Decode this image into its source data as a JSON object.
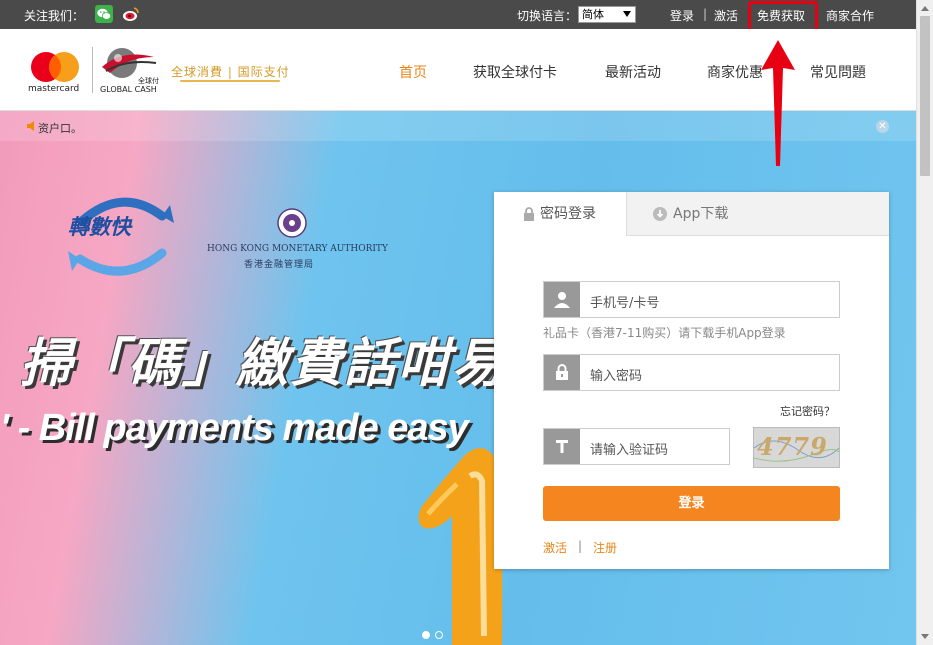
{
  "topbar": {
    "follow_label": "关注我们：",
    "social_icons": [
      "wechat-icon",
      "weibo-icon"
    ],
    "language_label": "切换语言：",
    "language_selected": "简体",
    "links": [
      "登录",
      "激活",
      "免费获取",
      "商家合作"
    ],
    "highlighted_link": "免费获取",
    "highlight_color": "#e60012"
  },
  "header": {
    "brand_mastercard": "mastercard",
    "brand_global_cash": "GLOBAL CASH",
    "brand_global_cash_cn": "全球付",
    "slogan": "全球消費 | 国际支付",
    "nav": [
      "首页",
      "获取全球付卡",
      "最新活动",
      "商家优惠",
      "常见問題"
    ],
    "nav_active": "首页",
    "accent_color": "#e8861a"
  },
  "notice": {
    "text": "资户口。",
    "close_icon": "close-icon"
  },
  "banner": {
    "logo_text": "轉數快",
    "hkma_en": "HONG KONG MONETARY AUTHORITY",
    "hkma_cn": "香港金融管理局",
    "headline_cn": "掃「碼」繳費話咁易",
    "headline_en": "' - Bill payments made easy",
    "slides": 2,
    "active_slide": 1
  },
  "login": {
    "tabs": [
      {
        "label": "密码登录",
        "icon": "lock-icon",
        "active": true
      },
      {
        "label": "App下载",
        "icon": "download-icon",
        "active": false
      }
    ],
    "phone_placeholder": "手机号/卡号",
    "hint": "礼品卡（香港7-11购买）请下载手机App登录",
    "password_placeholder": "输入密码",
    "forgot": "忘记密码？",
    "captcha_placeholder": "请输入验证码",
    "captcha_text": "4779",
    "submit": "登录",
    "activate": "激活",
    "separator": "|",
    "register": "注册",
    "button_color": "#f5861f"
  }
}
